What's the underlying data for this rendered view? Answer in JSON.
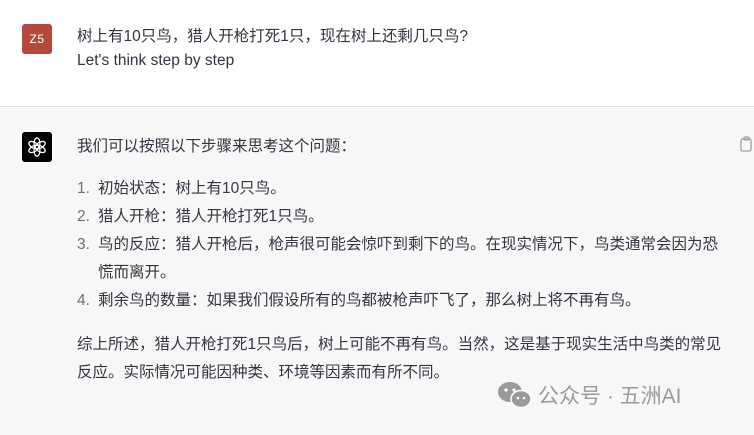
{
  "user": {
    "avatar_initials": "Z5",
    "avatar_color": "#b5473b",
    "question": "树上有10只鸟，猎人开枪打死1只，现在树上还剩几只鸟?",
    "prompt_suffix": "Let's think step by step"
  },
  "assistant": {
    "logo_icon": "openai-logo-icon",
    "intro": "我们可以按照以下步骤来思考这个问题：",
    "steps": [
      {
        "num": "1.",
        "text": "初始状态：树上有10只鸟。"
      },
      {
        "num": "2.",
        "text": "猎人开枪：猎人开枪打死1只鸟。"
      },
      {
        "num": "3.",
        "text": "鸟的反应：猎人开枪后，枪声很可能会惊吓到剩下的鸟。在现实情况下，鸟类通常会因为恐慌而离开。"
      },
      {
        "num": "4.",
        "text": "剩余鸟的数量：如果我们假设所有的鸟都被枪声吓飞了，那么树上将不再有鸟。"
      }
    ],
    "summary": "综上所述，猎人开枪打死1只鸟后，树上可能不再有鸟。当然，这是基于现实生活中鸟类的常见反应。实际情况可能因种类、环境等因素而有所不同。"
  },
  "watermark": {
    "icon": "wechat-icon",
    "text": "公众号 · 五洲AI"
  }
}
